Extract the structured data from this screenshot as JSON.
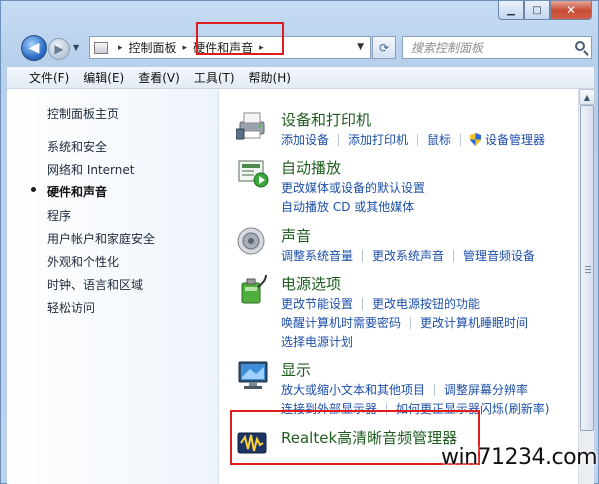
{
  "window": {
    "caption": {
      "minimize": "▁",
      "maximize": "□",
      "close": "✕"
    }
  },
  "nav": {
    "back_glyph": "◀",
    "forward_glyph": "▶",
    "history_glyph": "▼",
    "breadcrumb": [
      "控制面板",
      "硬件和声音"
    ],
    "breadcrumb_sep": "▸",
    "address_dropdown_glyph": "▼",
    "refresh_glyph": "⟳",
    "search_placeholder": "搜索控制面板"
  },
  "menu": [
    "文件(F)",
    "编辑(E)",
    "查看(V)",
    "工具(T)",
    "帮助(H)"
  ],
  "sidebar": {
    "items": [
      "控制面板主页",
      "系统和安全",
      "网络和 Internet",
      "硬件和声音",
      "程序",
      "用户帐户和家庭安全",
      "外观和个性化",
      "时钟、语言和区域",
      "轻松访问"
    ],
    "active_index": 3
  },
  "categories": [
    {
      "icon": "printer-icon",
      "title": "设备和打印机",
      "rows": [
        [
          "添加设备",
          "添加打印机",
          "鼠标",
          "设备管理器"
        ]
      ]
    },
    {
      "icon": "autoplay-icon",
      "title": "自动播放",
      "rows": [
        [
          "更改媒体或设备的默认设置"
        ],
        [
          "自动播放 CD 或其他媒体"
        ]
      ]
    },
    {
      "icon": "speaker-icon",
      "title": "声音",
      "rows": [
        [
          "调整系统音量",
          "更改系统声音",
          "管理音频设备"
        ]
      ]
    },
    {
      "icon": "power-icon",
      "title": "电源选项",
      "rows": [
        [
          "更改节能设置",
          "更改电源按钮的功能"
        ],
        [
          "唤醒计算机时需要密码",
          "更改计算机睡眠时间"
        ],
        [
          "选择电源计划"
        ]
      ]
    },
    {
      "icon": "display-icon",
      "title": "显示",
      "rows": [
        [
          "放大或缩小文本和其他项目",
          "调整屏幕分辨率"
        ],
        [
          "连接到外部显示器",
          "如何更正显示器闪烁(刷新率)"
        ]
      ]
    },
    {
      "icon": "realtek-audio-icon",
      "title": "Realtek高清晰音频管理器",
      "rows": []
    }
  ],
  "scrollbar": {
    "up_glyph": "▲"
  },
  "watermark": {
    "text": "win71234.com"
  },
  "colors": {
    "highlight": "#e01d1d",
    "link": "#1c4fa8",
    "category_title": "#1f5d1f"
  }
}
